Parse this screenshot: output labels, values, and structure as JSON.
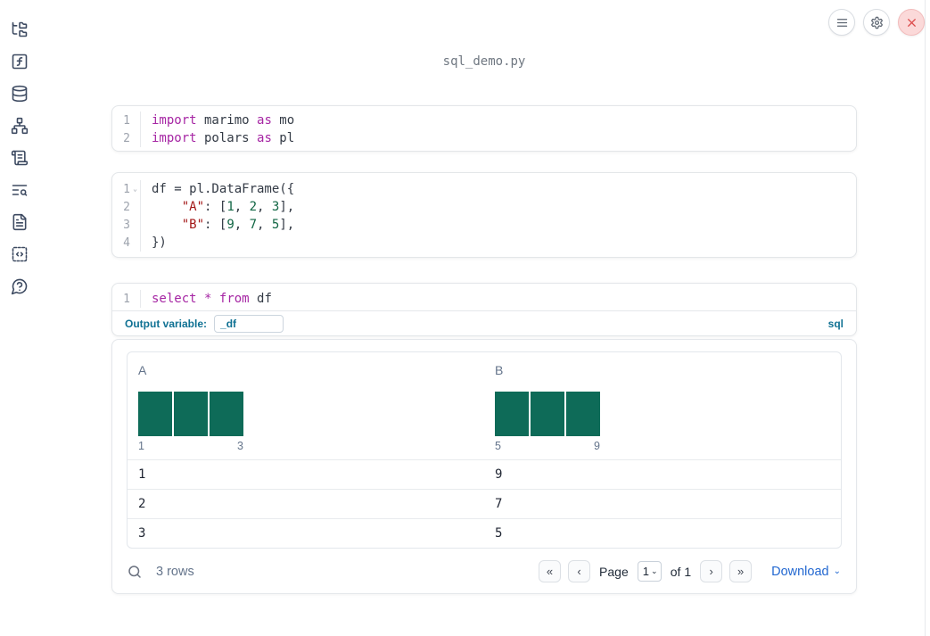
{
  "app": {
    "title": "sql_demo.py"
  },
  "topbar": {
    "buttons": [
      {
        "icon": "menu-icon"
      },
      {
        "icon": "gear-icon"
      },
      {
        "icon": "close-icon"
      }
    ]
  },
  "sidebar": {
    "icons": [
      "file-tree-icon",
      "function-square-icon",
      "database-icon",
      "dependency-graph-icon",
      "scroll-icon",
      "table-search-icon",
      "document-icon",
      "code-square-icon",
      "help-icon"
    ]
  },
  "icons": {
    "caret_down": "⌄",
    "fold_chevron": "⌄"
  },
  "colors": {
    "accent_sql": "#0f7193",
    "histogram_bar": "#0e6b58",
    "keyword": "#a626a4",
    "string": "#a31717",
    "number": "#116644",
    "link_blue": "#2368d1"
  },
  "cells": [
    {
      "type": "python",
      "lines": [
        {
          "n": "1",
          "tokens": [
            {
              "t": "kw",
              "v": "import"
            },
            {
              "t": "pl",
              "v": " marimo "
            },
            {
              "t": "kw",
              "v": "as"
            },
            {
              "t": "pl",
              "v": " mo"
            }
          ]
        },
        {
          "n": "2",
          "tokens": [
            {
              "t": "kw",
              "v": "import"
            },
            {
              "t": "pl",
              "v": " polars "
            },
            {
              "t": "kw",
              "v": "as"
            },
            {
              "t": "pl",
              "v": " pl"
            }
          ]
        }
      ]
    },
    {
      "type": "python",
      "lines": [
        {
          "n": "1",
          "fold": true,
          "tokens": [
            {
              "t": "pl",
              "v": "df = pl.DataFrame({"
            }
          ]
        },
        {
          "n": "2",
          "tokens": [
            {
              "t": "pl",
              "v": "    "
            },
            {
              "t": "str",
              "v": "\"A\""
            },
            {
              "t": "pl",
              "v": ": ["
            },
            {
              "t": "num",
              "v": "1"
            },
            {
              "t": "pl",
              "v": ", "
            },
            {
              "t": "num",
              "v": "2"
            },
            {
              "t": "pl",
              "v": ", "
            },
            {
              "t": "num",
              "v": "3"
            },
            {
              "t": "pl",
              "v": "],"
            }
          ]
        },
        {
          "n": "3",
          "tokens": [
            {
              "t": "pl",
              "v": "    "
            },
            {
              "t": "str",
              "v": "\"B\""
            },
            {
              "t": "pl",
              "v": ": ["
            },
            {
              "t": "num",
              "v": "9"
            },
            {
              "t": "pl",
              "v": ", "
            },
            {
              "t": "num",
              "v": "7"
            },
            {
              "t": "pl",
              "v": ", "
            },
            {
              "t": "num",
              "v": "5"
            },
            {
              "t": "pl",
              "v": "],"
            }
          ]
        },
        {
          "n": "4",
          "tokens": [
            {
              "t": "pl",
              "v": "})"
            }
          ]
        }
      ]
    },
    {
      "type": "sql",
      "lines": [
        {
          "n": "1",
          "tokens": [
            {
              "t": "kw",
              "v": "select"
            },
            {
              "t": "pl",
              "v": " "
            },
            {
              "t": "kw",
              "v": "*"
            },
            {
              "t": "pl",
              "v": " "
            },
            {
              "t": "kw",
              "v": "from"
            },
            {
              "t": "pl",
              "v": " df"
            }
          ]
        }
      ]
    }
  ],
  "sql_meta": {
    "label": "Output variable:",
    "value": "_df",
    "badge": "sql"
  },
  "table": {
    "columns": [
      {
        "name": "A",
        "hist": {
          "bars": [
            1,
            1,
            1
          ],
          "min_label": "1",
          "max_label": "3"
        }
      },
      {
        "name": "B",
        "hist": {
          "bars": [
            1,
            1,
            1
          ],
          "min_label": "5",
          "max_label": "9"
        }
      }
    ],
    "rows": [
      [
        "1",
        "9"
      ],
      [
        "2",
        "7"
      ],
      [
        "3",
        "5"
      ]
    ],
    "footer": {
      "rows_text": "3 rows",
      "pager": [
        {
          "icon": "first-page-icon",
          "glyph": "«"
        },
        {
          "icon": "prev-page-icon",
          "glyph": "‹"
        },
        {
          "icon": "next-page-icon",
          "glyph": "›"
        },
        {
          "icon": "last-page-icon",
          "glyph": "»"
        }
      ],
      "page_label": "Page",
      "page_value": "1",
      "of_text": "of 1",
      "download": "Download"
    }
  }
}
